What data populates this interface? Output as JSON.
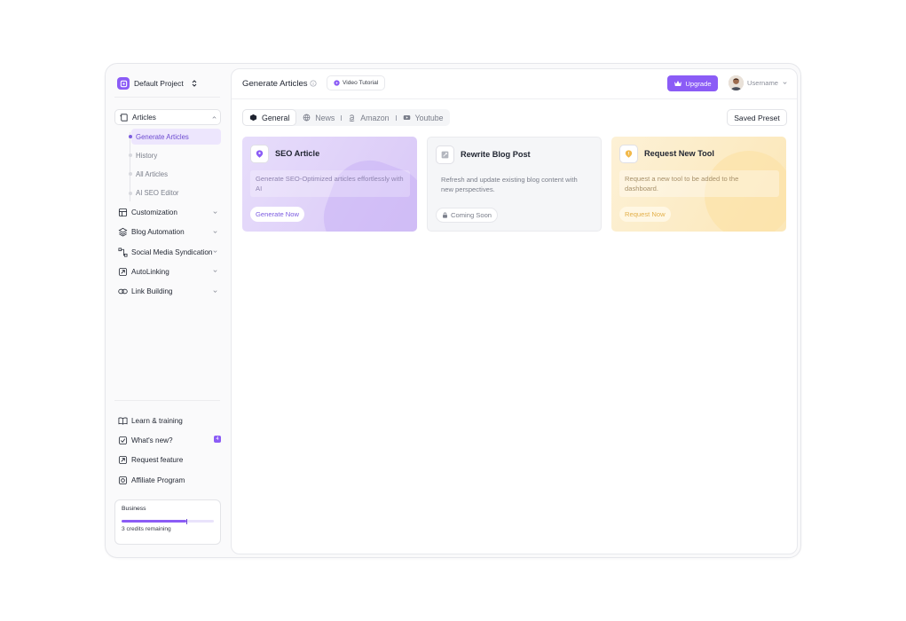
{
  "project": {
    "name": "Default Project"
  },
  "sidebar": {
    "articles": {
      "label": "Articles",
      "items": [
        {
          "label": "Generate Articles"
        },
        {
          "label": "History"
        },
        {
          "label": "All Articles"
        },
        {
          "label": "AI SEO Editor"
        }
      ]
    },
    "groups": [
      {
        "label": "Customization"
      },
      {
        "label": "Blog Automation"
      },
      {
        "label": "Social Media Syndication"
      },
      {
        "label": "AutoLinking"
      },
      {
        "label": "Link Building"
      }
    ],
    "bottom": [
      {
        "label": "Learn & training"
      },
      {
        "label": "What's new?",
        "badge": "4"
      },
      {
        "label": "Request feature"
      },
      {
        "label": "Affiliate Program"
      }
    ],
    "plan": {
      "name": "Business",
      "credits": "3 credits remaining",
      "progress": 0.7
    }
  },
  "header": {
    "title": "Generate Articles",
    "video_tutorial": "Video Tutorial",
    "upgrade": "Upgrade",
    "username": "Username"
  },
  "tabs": [
    {
      "label": "General",
      "icon": "cube-icon"
    },
    {
      "label": "News",
      "icon": "globe-icon"
    },
    {
      "label": "Amazon",
      "icon": "amazon-icon"
    },
    {
      "label": "Youtube",
      "icon": "youtube-icon"
    }
  ],
  "saved_preset": "Saved Preset",
  "cards": [
    {
      "title": "SEO Article",
      "desc": "Generate SEO-Optimized articles effortlessly with AI",
      "button": "Generate Now"
    },
    {
      "title": "Rewrite Blog Post",
      "desc": "Refresh and update existing blog content with new perspectives.",
      "button": "Coming Soon"
    },
    {
      "title": "Request New Tool",
      "desc": "Request a new tool to be added to the dashboard.",
      "button": "Request Now"
    }
  ],
  "colors": {
    "accent": "#8b5cf6",
    "active_bg": "#ede6fd",
    "request_accent": "#e3b04b"
  }
}
